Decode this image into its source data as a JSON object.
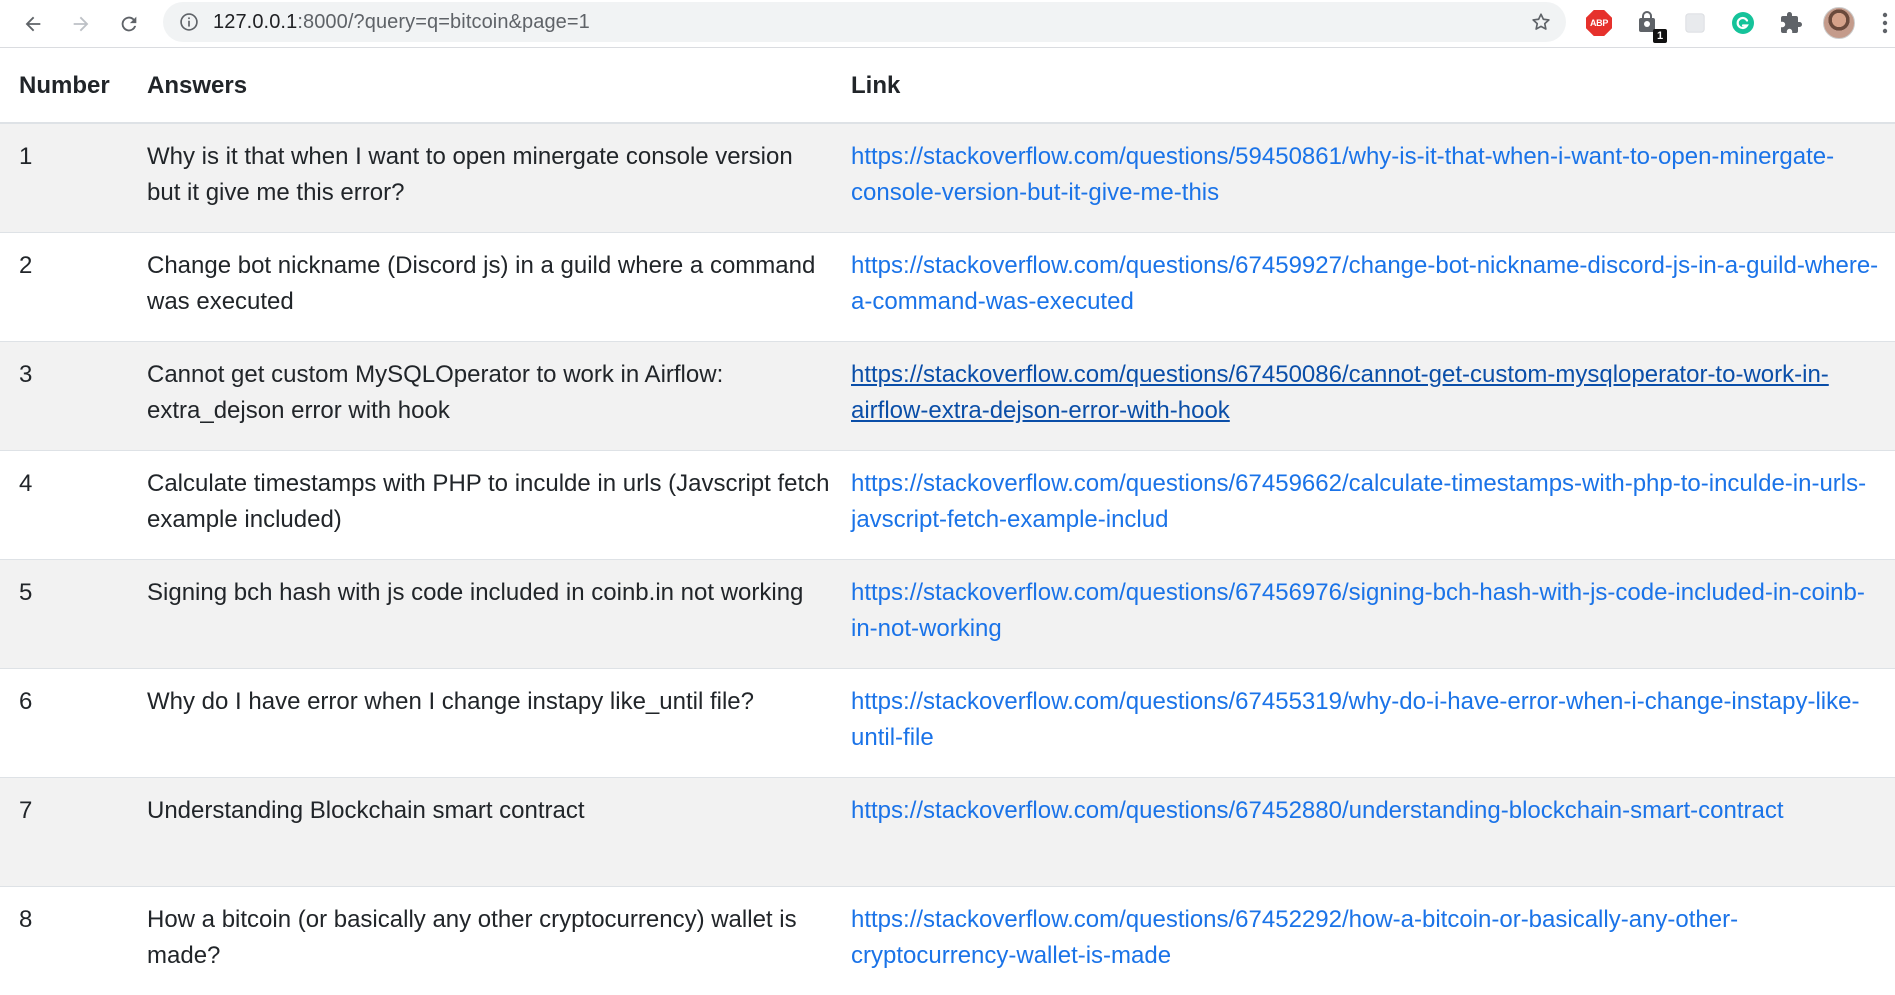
{
  "browser": {
    "url_host": "127.0.0.1",
    "url_rest": ":8000/?query=q=bitcoin&page=1",
    "extensions": [
      {
        "name": "adblock-plus",
        "label": "ABP"
      },
      {
        "name": "extension-badge",
        "badge": "1"
      },
      {
        "name": "extension-blank"
      },
      {
        "name": "grammarly"
      },
      {
        "name": "extensions-puzzle"
      }
    ]
  },
  "table": {
    "headers": {
      "number": "Number",
      "answers": "Answers",
      "link": "Link"
    },
    "rows": [
      {
        "number": "1",
        "answer": "Why is it that when I want to open minergate console version but it give me this error?",
        "link": "https://stackoverflow.com/questions/59450861/why-is-it-that-when-i-want-to-open-minergate-console-version-but-it-give-me-this"
      },
      {
        "number": "2",
        "answer": "Change bot nickname (Discord js) in a guild where a command was executed",
        "link": "https://stackoverflow.com/questions/67459927/change-bot-nickname-discord-js-in-a-guild-where-a-command-was-executed"
      },
      {
        "number": "3",
        "answer": "Cannot get custom MySQLOperator to work in Airflow: extra_dejson error with hook",
        "link": "https://stackoverflow.com/questions/67450086/cannot-get-custom-mysqloperator-to-work-in-airflow-extra-dejson-error-with-hook"
      },
      {
        "number": "4",
        "answer": "Calculate timestamps with PHP to inculde in urls (Javscript fetch example included)",
        "link": "https://stackoverflow.com/questions/67459662/calculate-timestamps-with-php-to-inculde-in-urls-javscript-fetch-example-includ"
      },
      {
        "number": "5",
        "answer": "Signing bch hash with js code included in coinb.in not working",
        "link": "https://stackoverflow.com/questions/67456976/signing-bch-hash-with-js-code-included-in-coinb-in-not-working"
      },
      {
        "number": "6",
        "answer": "Why do I have error when I change instapy like_until file?",
        "link": "https://stackoverflow.com/questions/67455319/why-do-i-have-error-when-i-change-instapy-like-until-file"
      },
      {
        "number": "7",
        "answer": "Understanding Blockchain smart contract",
        "link": "https://stackoverflow.com/questions/67452880/understanding-blockchain-smart-contract"
      },
      {
        "number": "8",
        "answer": "How a bitcoin (or basically any other cryptocurrency) wallet is made?",
        "link": "https://stackoverflow.com/questions/67452292/how-a-bitcoin-or-basically-any-other-cryptocurrency-wallet-is-made"
      }
    ]
  },
  "colors": {
    "link": "#1a73e8",
    "link_hover": "#0a4ea8",
    "stripe": "#f2f2f2",
    "text": "#212529"
  }
}
